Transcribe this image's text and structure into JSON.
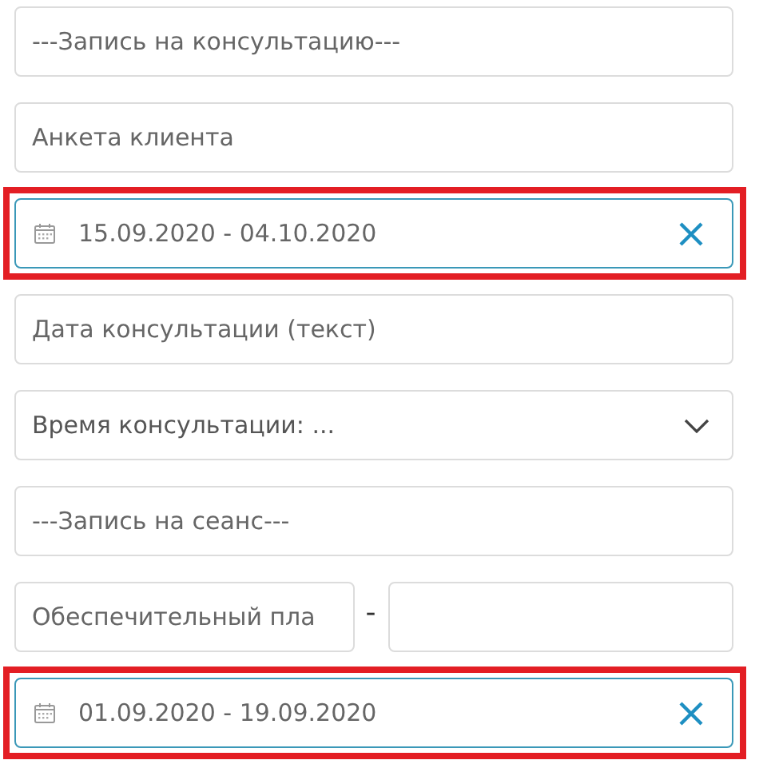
{
  "fields": [
    {
      "kind": "text",
      "placeholder": "---Запись на консультацию---",
      "highlighted": false
    },
    {
      "kind": "text",
      "placeholder": "Анкета клиента",
      "highlighted": false
    },
    {
      "kind": "daterange",
      "value": "15.09.2020 - 04.10.2020",
      "highlighted": true
    },
    {
      "kind": "text",
      "placeholder": "Дата консультации (текст)",
      "highlighted": false
    },
    {
      "kind": "select",
      "placeholder": "Время консультации: ...",
      "highlighted": false
    },
    {
      "kind": "text",
      "placeholder": "---Запись на сеанс---",
      "highlighted": false
    },
    {
      "kind": "pair",
      "placeholder": "Обеспечительный пла",
      "separator": "-",
      "highlighted": false
    },
    {
      "kind": "daterange",
      "value": "01.09.2020 - 19.09.2020",
      "highlighted": true
    }
  ]
}
